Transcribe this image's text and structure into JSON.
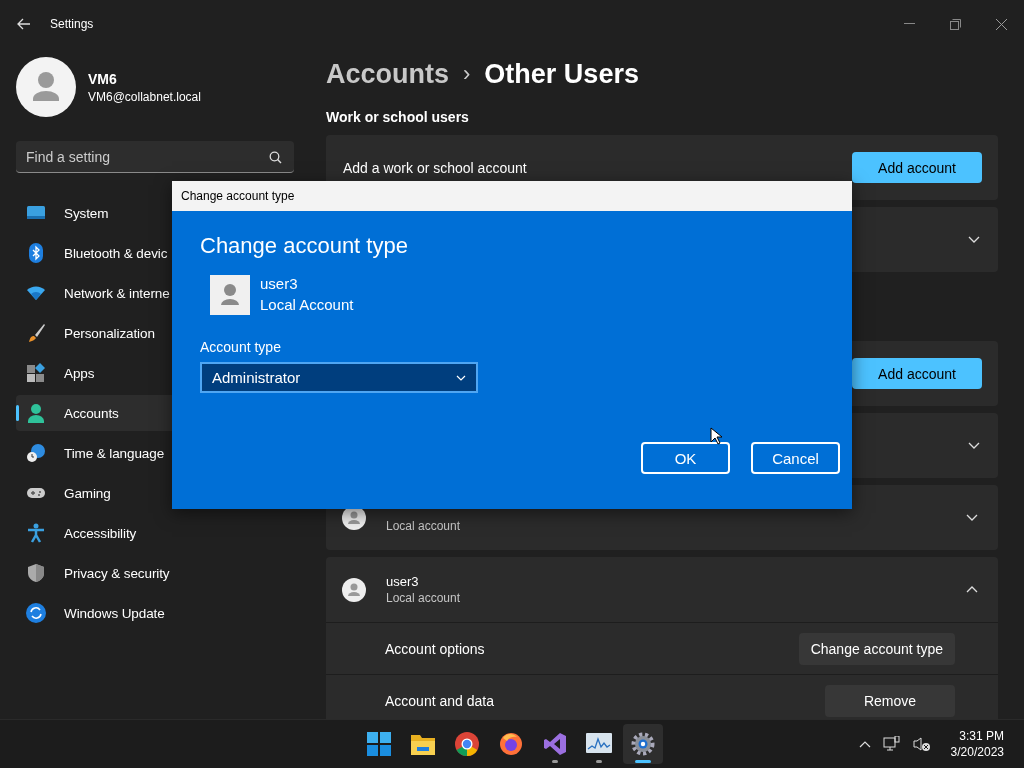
{
  "window": {
    "title": "Settings"
  },
  "profile": {
    "name": "VM6",
    "email": "VM6@collabnet.local"
  },
  "search": {
    "placeholder": "Find a setting"
  },
  "sidebar": {
    "items": [
      {
        "label": "System",
        "kind": "system",
        "selected": false
      },
      {
        "label": "Bluetooth & devic",
        "kind": "bluetooth",
        "selected": false
      },
      {
        "label": "Network & interne",
        "kind": "network",
        "selected": false
      },
      {
        "label": "Personalization",
        "kind": "brush",
        "selected": false
      },
      {
        "label": "Apps",
        "kind": "apps",
        "selected": false
      },
      {
        "label": "Accounts",
        "kind": "accounts",
        "selected": true
      },
      {
        "label": "Time & language",
        "kind": "time",
        "selected": false
      },
      {
        "label": "Gaming",
        "kind": "gaming",
        "selected": false
      },
      {
        "label": "Accessibility",
        "kind": "accessibility",
        "selected": false
      },
      {
        "label": "Privacy & security",
        "kind": "shield",
        "selected": false
      },
      {
        "label": "Windows Update",
        "kind": "update",
        "selected": false
      }
    ]
  },
  "breadcrumb": {
    "parent": "Accounts",
    "separator": "›",
    "current": "Other Users"
  },
  "groups": [
    {
      "heading": "Work or school users",
      "rows": [
        {
          "kind": "action",
          "label": "Add a work or school account",
          "button": "Add account"
        },
        {
          "kind": "collapsed"
        }
      ]
    },
    {
      "rows": [
        {
          "kind": "action",
          "button": "Add account"
        },
        {
          "kind": "collapsed"
        },
        {
          "kind": "user",
          "subtitle": "Local account",
          "expanded": false
        },
        {
          "kind": "user",
          "name": "user3",
          "subtitle": "Local account",
          "expanded": true,
          "options": [
            {
              "label": "Account options",
              "button": "Change account type"
            },
            {
              "label": "Account and data",
              "button": "Remove"
            }
          ]
        }
      ]
    }
  ],
  "dialog": {
    "title": "Change account type",
    "heading": "Change account type",
    "user": {
      "name": "user3",
      "type": "Local Account"
    },
    "field_label": "Account type",
    "select": {
      "value": "Administrator"
    },
    "buttons": [
      "OK",
      "Cancel"
    ]
  },
  "taskbar": {
    "apps": [
      {
        "kind": "start",
        "running": false,
        "selected": false
      },
      {
        "kind": "explorer",
        "running": false,
        "selected": false
      },
      {
        "kind": "chrome",
        "running": false,
        "selected": false
      },
      {
        "kind": "firefox",
        "running": false,
        "selected": false
      },
      {
        "kind": "studio",
        "running": true,
        "selected": false
      },
      {
        "kind": "monitor",
        "running": true,
        "selected": false
      },
      {
        "kind": "settings",
        "running": true,
        "selected": true
      }
    ],
    "time": "3:31 PM",
    "date": "3/20/2023"
  }
}
